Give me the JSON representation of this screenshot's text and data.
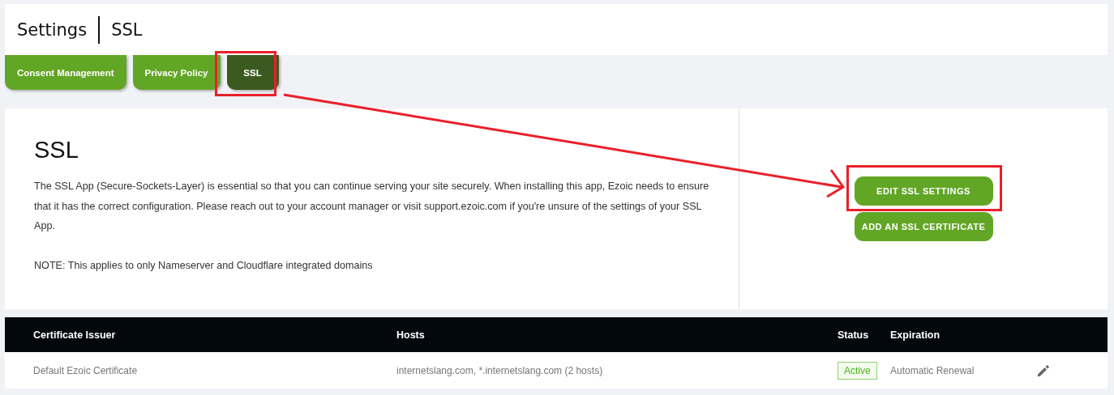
{
  "header": {
    "title": "Settings",
    "subtitle": "SSL"
  },
  "tabs": [
    {
      "label": "Consent Management",
      "selected": false
    },
    {
      "label": "Privacy Policy",
      "selected": false
    },
    {
      "label": "SSL",
      "selected": true
    }
  ],
  "panel": {
    "heading": "SSL",
    "description": "The SSL App (Secure-Sockets-Layer) is essential so that you can continue serving your site securely. When installing this app, Ezoic needs to ensure that it has the correct configuration. Please reach out to your account manager or visit support.ezoic.com if you're unsure of the settings of your SSL App.",
    "note": "NOTE: This applies to only Nameserver and Cloudflare integrated domains",
    "buttons": [
      "EDIT SSL SETTINGS",
      "ADD AN SSL CERTIFICATE"
    ]
  },
  "table": {
    "columns": [
      "Certificate Issuer",
      "Hosts",
      "Status",
      "Expiration"
    ],
    "rows": [
      {
        "issuer": "Default Ezoic Certificate",
        "hosts": "internetslang.com, *.internetslang.com (2 hosts)",
        "status": "Active",
        "expiration": "Automatic Renewal"
      }
    ]
  }
}
